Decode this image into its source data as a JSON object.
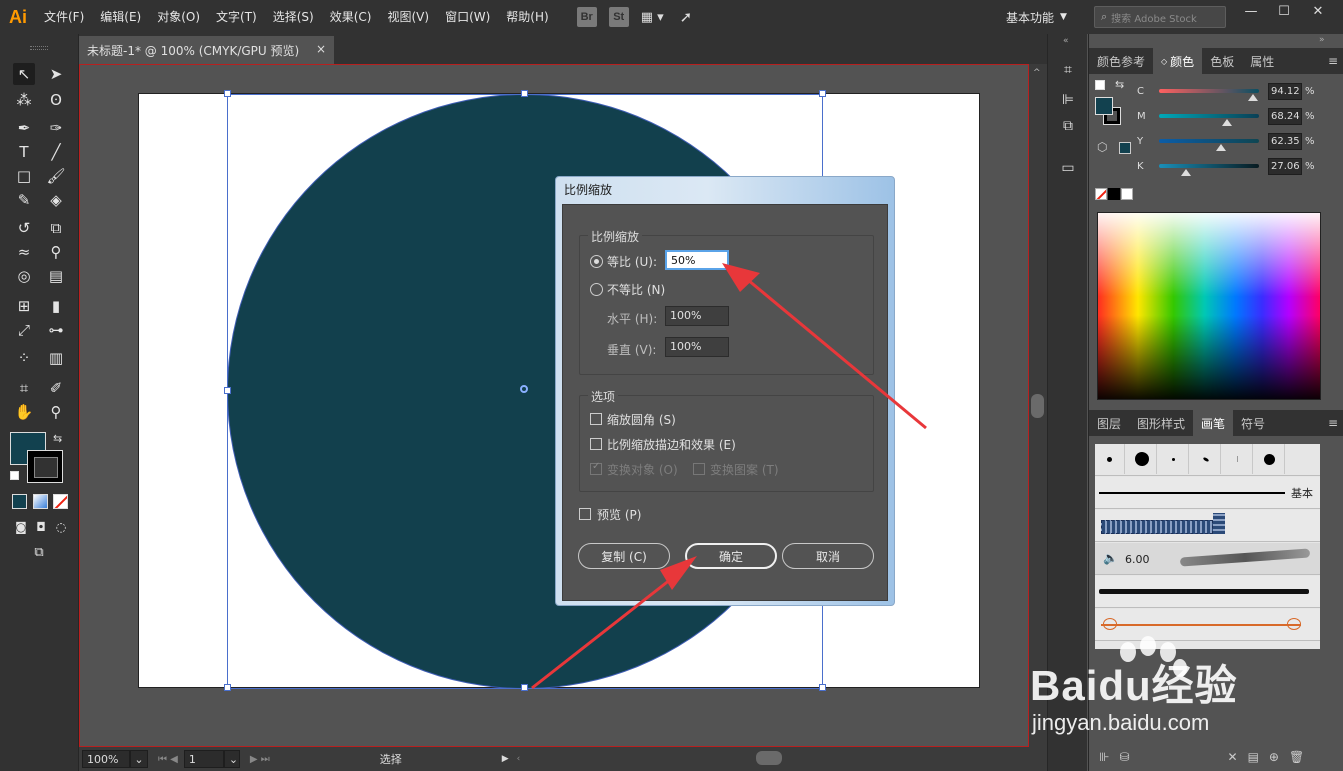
{
  "app": {
    "logo": "Ai"
  },
  "menu": [
    "文件(F)",
    "编辑(E)",
    "对象(O)",
    "文字(T)",
    "选择(S)",
    "效果(C)",
    "视图(V)",
    "窗口(W)",
    "帮助(H)"
  ],
  "menubar_icons": {
    "bridge": "Br",
    "stock": "St"
  },
  "workspace": "基本功能",
  "search": {
    "placeholder": "搜索 Adobe Stock"
  },
  "document": {
    "tab_title": "未标题-1* @ 100% (CMYK/GPU 预览)",
    "close": "×"
  },
  "status": {
    "zoom": "100%",
    "page": "1",
    "tool": "选择"
  },
  "colors": {
    "fill": "#12414f",
    "accent_red": "#e8373a",
    "canvas_bg": "#535353",
    "chrome": "#323232"
  },
  "color_panel": {
    "tabs": [
      "颜色参考",
      "颜色",
      "色板",
      "属性"
    ],
    "active_tab": "颜色",
    "channels": [
      {
        "label": "C",
        "value": "94.12",
        "pct": "%",
        "level": 0.94,
        "gradient": "linear-gradient(to right,#ff6060,#0a4f62)"
      },
      {
        "label": "M",
        "value": "68.24",
        "pct": "%",
        "level": 0.68,
        "gradient": "linear-gradient(to right,#00a8b8,#0a3f55)"
      },
      {
        "label": "Y",
        "value": "62.35",
        "pct": "%",
        "level": 0.62,
        "gradient": "linear-gradient(to right,#0c5da8,#0f4652)"
      },
      {
        "label": "K",
        "value": "27.06",
        "pct": "%",
        "level": 0.27,
        "gradient": "linear-gradient(to right,#1a8fb8,#081a20)"
      }
    ]
  },
  "brush_panel": {
    "tabs": [
      "图层",
      "图形样式",
      "画笔",
      "符号"
    ],
    "active_tab": "画笔",
    "basic_label": "基本",
    "brush_size": "6.00"
  },
  "dialog": {
    "title": "比例缩放",
    "group_scale": "比例缩放",
    "uniform_label": "等比 (U):",
    "uniform_value": "50%",
    "nonuniform_label": "不等比 (N)",
    "horizontal_label": "水平 (H):",
    "horizontal_value": "100%",
    "vertical_label": "垂直 (V):",
    "vertical_value": "100%",
    "group_options": "选项",
    "scale_corners": "缩放圆角 (S)",
    "scale_strokes": "比例缩放描边和效果 (E)",
    "transform_objects": "变换对象 (O)",
    "transform_patterns": "变换图案 (T)",
    "preview": "预览 (P)",
    "copy_button": "复制 (C)",
    "ok_button": "确定",
    "cancel_button": "取消"
  },
  "watermark": {
    "brand": "Baidu经验",
    "url": "jingyan.baidu.com"
  }
}
